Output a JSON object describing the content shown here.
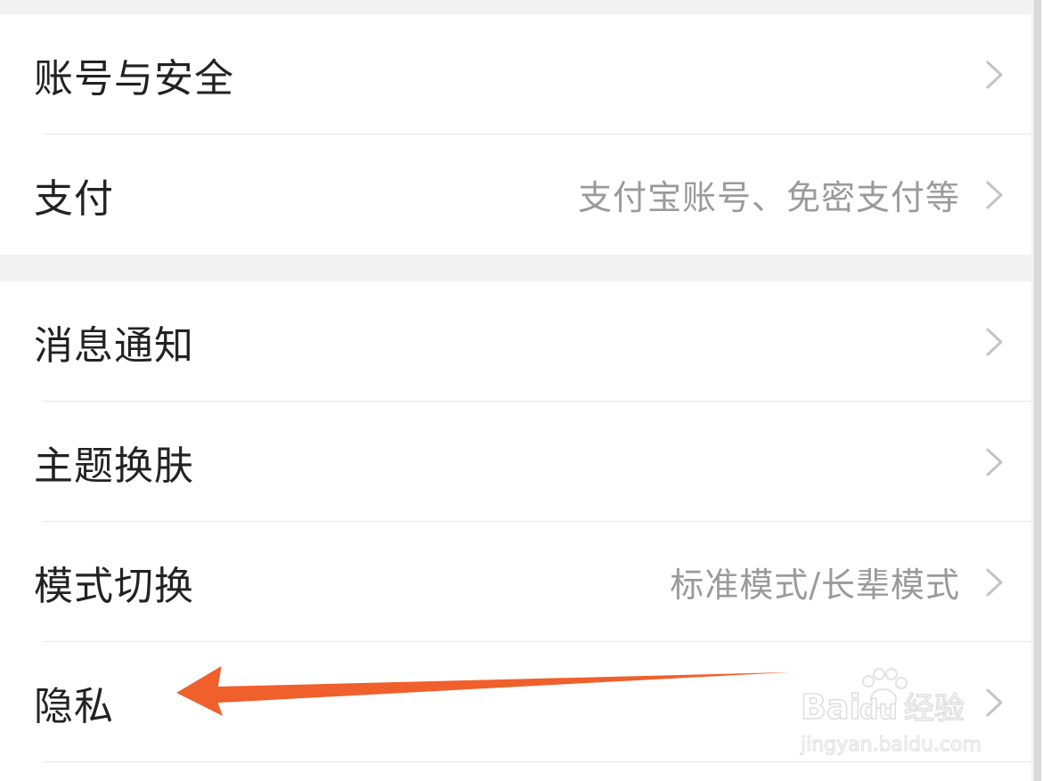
{
  "groups": [
    {
      "items": [
        {
          "label": "账号与安全",
          "hint": ""
        },
        {
          "label": "支付",
          "hint": "支付宝账号、免密支付等"
        }
      ]
    },
    {
      "items": [
        {
          "label": "消息通知",
          "hint": ""
        },
        {
          "label": "主题换肤",
          "hint": ""
        },
        {
          "label": "模式切换",
          "hint": "标准模式/长辈模式"
        },
        {
          "label": "隐私",
          "hint": ""
        }
      ]
    }
  ],
  "annotation": {
    "arrow_color": "#f0602c",
    "points_to": "隐私"
  },
  "watermark": {
    "brand": "Baidu经验",
    "url": "jingyan.baidu.com"
  },
  "colors": {
    "background": "#f2f2f2",
    "row_bg": "#ffffff",
    "label": "#222222",
    "hint": "#9a9a9a",
    "chevron": "#c4c4c4"
  }
}
